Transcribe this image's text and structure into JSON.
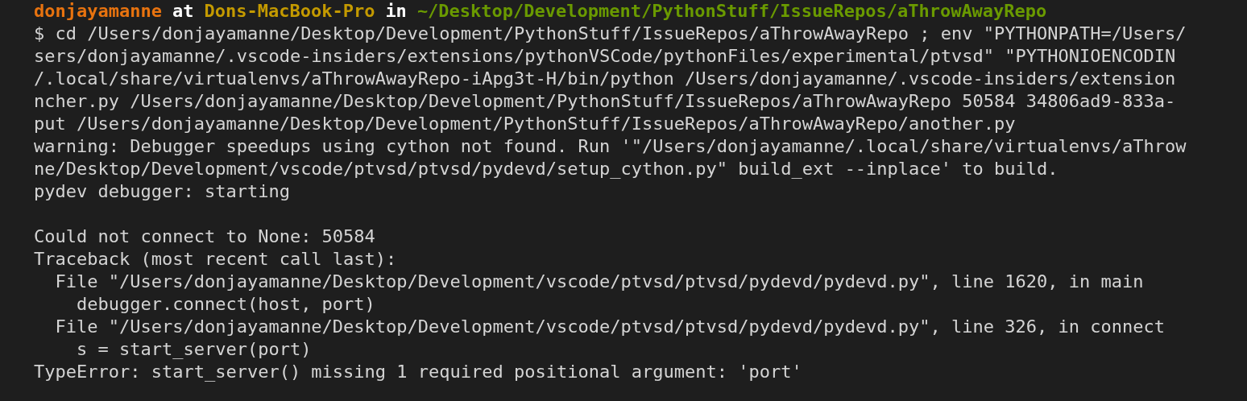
{
  "prompt": {
    "user": "donjayamanne",
    "at": "at",
    "host": "Dons-MacBook-Pro",
    "in": "in",
    "path": "~/Desktop/Development/PythonStuff/IssueRepos/aThrowAwayRepo"
  },
  "blocks": [
    {
      "lines": [
        "$ cd /Users/donjayamanne/Desktop/Development/PythonStuff/IssueRepos/aThrowAwayRepo ; env \"PYTHONPATH=/Users/",
        "sers/donjayamanne/.vscode-insiders/extensions/pythonVSCode/pythonFiles/experimental/ptvsd\" \"PYTHONIOENCODIN",
        "/.local/share/virtualenvs/aThrowAwayRepo-iApg3t-H/bin/python /Users/donjayamanne/.vscode-insiders/extension",
        "ncher.py /Users/donjayamanne/Desktop/Development/PythonStuff/IssueRepos/aThrowAwayRepo 50584 34806ad9-833a-",
        "put /Users/donjayamanne/Desktop/Development/PythonStuff/IssueRepos/aThrowAwayRepo/another.py",
        "warning: Debugger speedups using cython not found. Run '\"/Users/donjayamanne/.local/share/virtualenvs/aThrow",
        "ne/Desktop/Development/vscode/ptvsd/ptvsd/pydevd/setup_cython.py\" build_ext --inplace' to build.",
        "pydev debugger: starting"
      ]
    },
    {
      "lines": [
        "Could not connect to None: 50584",
        "Traceback (most recent call last):",
        "  File \"/Users/donjayamanne/Desktop/Development/vscode/ptvsd/ptvsd/pydevd/pydevd.py\", line 1620, in main",
        "    debugger.connect(host, port)",
        "  File \"/Users/donjayamanne/Desktop/Development/vscode/ptvsd/ptvsd/pydevd/pydevd.py\", line 326, in connect",
        "    s = start_server(port)",
        "TypeError: start_server() missing 1 required positional argument: 'port'"
      ]
    }
  ]
}
